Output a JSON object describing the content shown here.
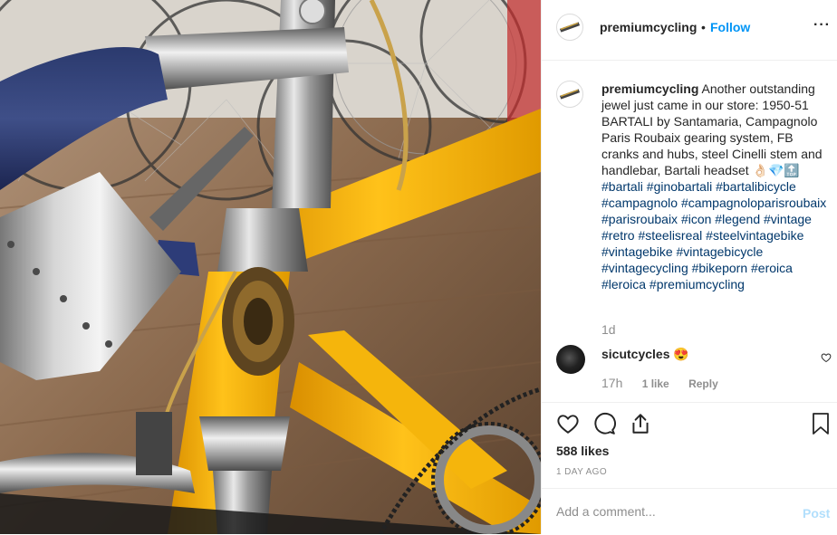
{
  "post": {
    "username": "premiumcycling",
    "dot": "•",
    "follow_label": "Follow",
    "more_label": "···",
    "caption_username": "premiumcycling",
    "caption_text": "Another outstanding jewel just came in our store: 1950-51 BARTALI by Santamaria, Campagnolo Paris Roubaix gearing system, FB cranks and hubs, steel Cinelli stem and handlebar, Bartali headset 👌🏻💎🔝",
    "hashtags": "#bartali #ginobartali #bartalibicycle #campagnolo #campagnoloparisroubaix #parisroubaix #icon #legend #vintage #retro #steelisreal #steelvintagebike #vintagebike #vintagebicycle #vintagecycling #bikeporn #eroica #leroica #premiumcycling",
    "caption_time": "1d",
    "likes": "588 likes",
    "date": "1 DAY AGO",
    "comment_placeholder": "Add a comment...",
    "post_label": "Post"
  },
  "comment": {
    "username": "sicutcycles",
    "text": "😍",
    "time": "17h",
    "likes": "1 like",
    "reply_label": "Reply"
  },
  "icons": {
    "like": "heart-icon",
    "comment": "comment-icon",
    "share": "share-icon",
    "save": "bookmark-icon",
    "comment_like": "heart-icon"
  },
  "colors": {
    "link": "#0095f6",
    "hashtag": "#00376b",
    "muted": "#8e8e8e",
    "post_disabled": "#b2dffc",
    "frame_yellow": "#f2b20a"
  }
}
